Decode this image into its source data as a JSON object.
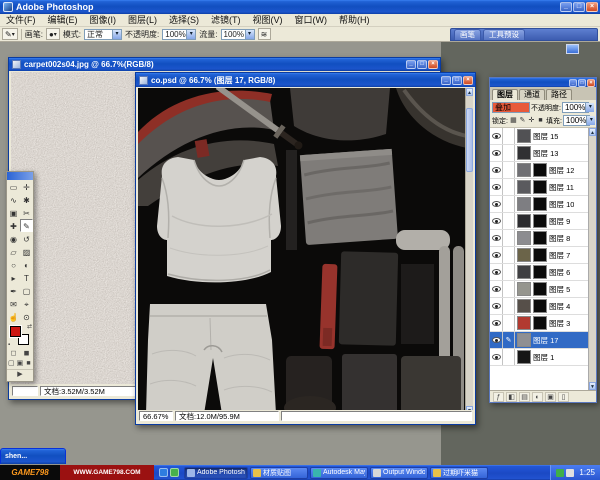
{
  "window": {
    "title": "Adobe Photoshop"
  },
  "glyphs": {
    "min": "_",
    "max": "□",
    "close": "×",
    "combo_arrow": "▾",
    "up": "▲",
    "down": "▼",
    "brush_indicator": "✎",
    "tool_brush": "✎",
    "airbrush": "≋",
    "brush_preset": "●",
    "swap_colors": "⇄",
    "default_colors": "▪"
  },
  "menu_bar": {
    "items": [
      "文件(F)",
      "编辑(E)",
      "图像(I)",
      "图层(L)",
      "选择(S)",
      "滤镜(T)",
      "视图(V)",
      "窗口(W)",
      "帮助(H)"
    ]
  },
  "options_bar": {
    "brush_label": "画笔:",
    "mode_label": "模式:",
    "mode_value": "正常",
    "opacity_label": "不透明度:",
    "opacity_value": "100%",
    "flow_label": "流量:",
    "flow_value": "100%",
    "palette_well_tabs": [
      "画笔",
      "工具预设"
    ]
  },
  "documents": {
    "back": {
      "title": "carpet002s04.jpg @ 66.7%(RGB/8)",
      "status_doc": "文档:3.52M/3.52M"
    },
    "front": {
      "title": "co.psd @ 66.7% (图层 17, RGB/8)",
      "zoom": "66.67%",
      "status_doc": "文档:12.0M/95.9M"
    }
  },
  "toolbox": {
    "tools": [
      {
        "name": "rectangular-marquee-tool",
        "glyph": "▭"
      },
      {
        "name": "move-tool",
        "glyph": "✛"
      },
      {
        "name": "lasso-tool",
        "glyph": "∿"
      },
      {
        "name": "magic-wand-tool",
        "glyph": "✱"
      },
      {
        "name": "crop-tool",
        "glyph": "▣"
      },
      {
        "name": "slice-tool",
        "glyph": "✂"
      },
      {
        "name": "healing-brush-tool",
        "glyph": "✚"
      },
      {
        "name": "brush-tool",
        "glyph": "✎",
        "active": true
      },
      {
        "name": "clone-stamp-tool",
        "glyph": "◉"
      },
      {
        "name": "history-brush-tool",
        "glyph": "↺"
      },
      {
        "name": "eraser-tool",
        "glyph": "▱"
      },
      {
        "name": "gradient-tool",
        "glyph": "▨"
      },
      {
        "name": "blur-tool",
        "glyph": "○"
      },
      {
        "name": "dodge-tool",
        "glyph": "◐"
      },
      {
        "name": "path-selection-tool",
        "glyph": "▸"
      },
      {
        "name": "type-tool",
        "glyph": "T"
      },
      {
        "name": "pen-tool",
        "glyph": "✒"
      },
      {
        "name": "shape-tool",
        "glyph": "▢"
      },
      {
        "name": "notes-tool",
        "glyph": "✉"
      },
      {
        "name": "eyedropper-tool",
        "glyph": "⌖"
      },
      {
        "name": "hand-tool",
        "glyph": "☝"
      },
      {
        "name": "zoom-tool",
        "glyph": "⊙"
      }
    ],
    "extras": [
      {
        "name": "standard-mode-icon",
        "glyph": "◻"
      },
      {
        "name": "quick-mask-mode-icon",
        "glyph": "◼"
      },
      {
        "name": "screen-mode-standard-icon",
        "glyph": "▢"
      },
      {
        "name": "screen-mode-menubar-icon",
        "glyph": "▣"
      },
      {
        "name": "screen-mode-full-icon",
        "glyph": "■"
      },
      {
        "name": "jump-to-imageready-icon",
        "glyph": "▶"
      }
    ]
  },
  "layers_panel": {
    "tabs": [
      "图层",
      "通道",
      "路径"
    ],
    "blend_mode": "叠加",
    "opacity_label": "不透明度:",
    "opacity_value": "100%",
    "lock_label": "锁定:",
    "fill_label": "填充:",
    "fill_value": "100%",
    "lock_icons": [
      {
        "name": "lock-transparent-pixels-icon",
        "glyph": "▦"
      },
      {
        "name": "lock-image-pixels-icon",
        "glyph": "✎"
      },
      {
        "name": "lock-position-icon",
        "glyph": "✛"
      },
      {
        "name": "lock-all-icon",
        "glyph": "■"
      }
    ],
    "layers": [
      {
        "name": "图层 15",
        "thumb": "#515154",
        "mask": false,
        "visible": true,
        "selected": false
      },
      {
        "name": "图层 13",
        "thumb": "#303033",
        "mask": false,
        "visible": true,
        "selected": false
      },
      {
        "name": "图层 12",
        "thumb": "#707074",
        "mask": true,
        "visible": true,
        "selected": false
      },
      {
        "name": "图层 11",
        "thumb": "#5a5a5e",
        "mask": true,
        "visible": true,
        "selected": false
      },
      {
        "name": "图层 10",
        "thumb": "#7e7e82",
        "mask": true,
        "visible": true,
        "selected": false
      },
      {
        "name": "图层 9",
        "thumb": "#2c2c2f",
        "mask": true,
        "visible": true,
        "selected": false
      },
      {
        "name": "图层 8",
        "thumb": "#8c8c90",
        "mask": true,
        "visible": true,
        "selected": false
      },
      {
        "name": "图层 7",
        "thumb": "#6b6449",
        "mask": true,
        "visible": true,
        "selected": false
      },
      {
        "name": "图层 6",
        "thumb": "#3f3f42",
        "mask": true,
        "visible": true,
        "selected": false
      },
      {
        "name": "图层 5",
        "thumb": "#95958e",
        "mask": true,
        "visible": true,
        "selected": false
      },
      {
        "name": "图层 4",
        "thumb": "#564f49",
        "mask": true,
        "visible": true,
        "selected": false
      },
      {
        "name": "图层 3",
        "thumb": "#b23a30",
        "mask": true,
        "visible": true,
        "selected": false
      },
      {
        "name": "图层 17",
        "thumb": "#8f8f93",
        "mask": false,
        "visible": true,
        "selected": true
      },
      {
        "name": "图层 1",
        "thumb": "#161616",
        "mask": false,
        "visible": true,
        "selected": false
      }
    ],
    "bottom_icons": [
      {
        "name": "layer-style-icon",
        "glyph": "ƒ"
      },
      {
        "name": "add-layer-mask-icon",
        "glyph": "◧"
      },
      {
        "name": "new-layer-set-icon",
        "glyph": "▤"
      },
      {
        "name": "adjustment-layer-icon",
        "glyph": "◐"
      },
      {
        "name": "new-layer-icon",
        "glyph": "▣"
      },
      {
        "name": "delete-layer-icon",
        "glyph": "▯"
      }
    ]
  },
  "taskbar": {
    "logo": "GAME798",
    "url": "WWW.GAME798.COM",
    "quick_launch": [
      {
        "name": "quick-launch-icon-1",
        "color": "#2e7de0"
      },
      {
        "name": "quick-launch-icon-2",
        "color": "#47b04b"
      }
    ],
    "buttons": [
      {
        "label": "Adobe Photoshop",
        "active": true,
        "icon_color": "#9db6e8"
      },
      {
        "label": "材质贴图",
        "active": false,
        "icon_color": "#e8c04a"
      },
      {
        "label": "Autodesk May...",
        "active": false,
        "icon_color": "#39b5ae"
      },
      {
        "label": "Output Window",
        "active": false,
        "icon_color": "#d8d8d8"
      },
      {
        "label": "过期吓米猫",
        "active": false,
        "icon_color": "#e8c04a"
      }
    ],
    "tray_icons": [
      {
        "name": "tray-icon-1",
        "color": "#3fae49"
      },
      {
        "name": "tray-icon-2",
        "color": "#e0e0e0"
      }
    ],
    "clock": "1:25"
  },
  "mini_window": {
    "title": "shen..."
  },
  "colors": {
    "selection_blue": "#316ac5",
    "blend_highlight": "#e85a3a",
    "foreground_color": "#cd1712"
  }
}
